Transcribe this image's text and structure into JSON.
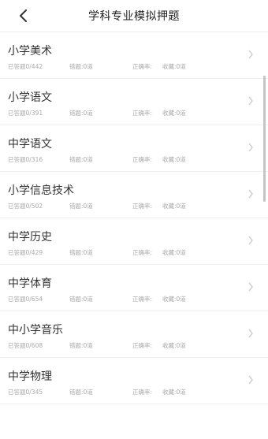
{
  "header": {
    "title": "学科专业模拟押题"
  },
  "subjects": [
    {
      "name": "小学美术",
      "answered": "已答题0/442",
      "wrong": "错题:0道",
      "accuracy": "正确率:",
      "favorites": "收藏:0道"
    },
    {
      "name": "小学语文",
      "answered": "已答题0/391",
      "wrong": "错题:0道",
      "accuracy": "正确率:",
      "favorites": "收藏:0道"
    },
    {
      "name": "中学语文",
      "answered": "已答题0/316",
      "wrong": "错题:0道",
      "accuracy": "正确率:",
      "favorites": "收藏:0道"
    },
    {
      "name": "小学信息技术",
      "answered": "已答题0/502",
      "wrong": "错题:0道",
      "accuracy": "正确率:",
      "favorites": "收藏:0道"
    },
    {
      "name": "中学历史",
      "answered": "已答题0/429",
      "wrong": "错题:0道",
      "accuracy": "正确率:",
      "favorites": "收藏:0道"
    },
    {
      "name": "中学体育",
      "answered": "已答题0/654",
      "wrong": "错题:0道",
      "accuracy": "正确率:",
      "favorites": "收藏:0道"
    },
    {
      "name": "中小学音乐",
      "answered": "已答题0/608",
      "wrong": "错题:0道",
      "accuracy": "正确率:",
      "favorites": "收藏:0道"
    },
    {
      "name": "中学物理",
      "answered": "已答题0/345",
      "wrong": "错题:0道",
      "accuracy": "正确率:",
      "favorites": "收藏:0道"
    }
  ],
  "icons": {
    "back": "back-arrow-icon",
    "chevron": "chevron-right-icon"
  },
  "colors": {
    "text_primary": "#333333",
    "text_secondary": "#a9a9a9",
    "divider": "#eeeeee"
  }
}
